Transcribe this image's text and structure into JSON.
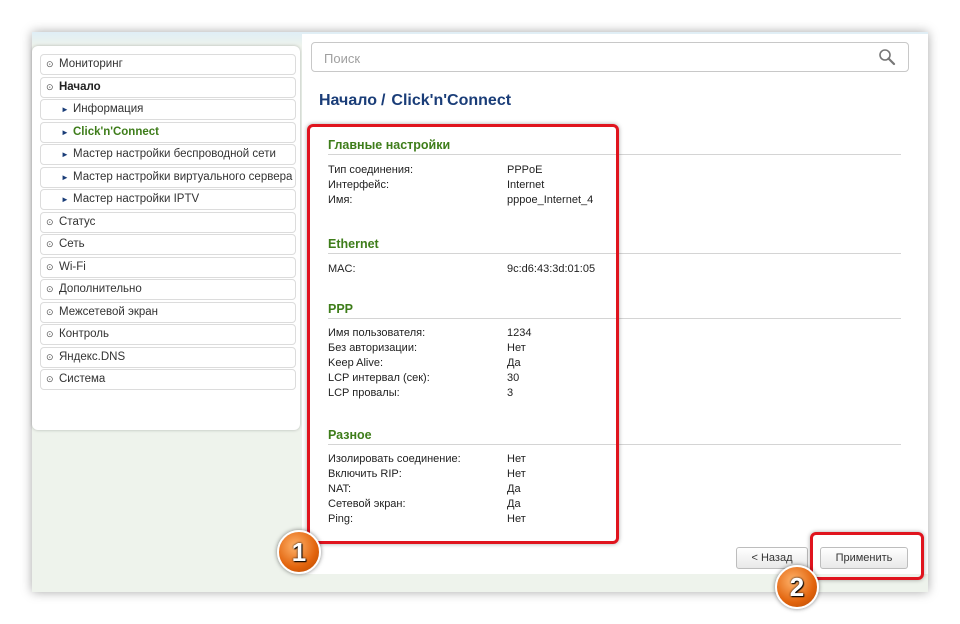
{
  "sidebar": {
    "items": [
      {
        "label": "Мониторинг",
        "level": 0,
        "icon": "circle-chevron-right-icon"
      },
      {
        "label": "Начало",
        "level": 0,
        "icon": "circle-chevron-down-icon"
      },
      {
        "label": "Информация",
        "level": 1,
        "icon": "triangle-right-icon"
      },
      {
        "label": "Click'n'Connect",
        "level": 1,
        "icon": "triangle-right-icon",
        "active": true
      },
      {
        "label": "Мастер настройки беспроводной сети",
        "level": 1,
        "icon": "triangle-right-icon"
      },
      {
        "label": "Мастер настройки виртуального сервера",
        "level": 1,
        "icon": "triangle-right-icon"
      },
      {
        "label": "Мастер настройки IPTV",
        "level": 1,
        "icon": "triangle-right-icon"
      },
      {
        "label": "Статус",
        "level": 0,
        "icon": "circle-chevron-right-icon"
      },
      {
        "label": "Сеть",
        "level": 0,
        "icon": "circle-chevron-right-icon"
      },
      {
        "label": "Wi-Fi",
        "level": 0,
        "icon": "circle-chevron-right-icon"
      },
      {
        "label": "Дополнительно",
        "level": 0,
        "icon": "circle-chevron-right-icon"
      },
      {
        "label": "Межсетевой экран",
        "level": 0,
        "icon": "circle-chevron-right-icon"
      },
      {
        "label": "Контроль",
        "level": 0,
        "icon": "circle-chevron-right-icon"
      },
      {
        "label": "Яндекс.DNS",
        "level": 0,
        "icon": "circle-chevron-right-icon"
      },
      {
        "label": "Система",
        "level": 0,
        "icon": "circle-chevron-right-icon"
      }
    ]
  },
  "search": {
    "placeholder": "Поиск",
    "value": "",
    "icon": "search-icon"
  },
  "breadcrumb": {
    "parent": "Начало",
    "separator": "/",
    "current": "Click'n'Connect"
  },
  "sections": {
    "main": {
      "title": "Главные настройки",
      "rows": [
        {
          "label": "Тип соединения:",
          "value": "PPPoE"
        },
        {
          "label": "Интерфейс:",
          "value": "Internet"
        },
        {
          "label": "Имя:",
          "value": "pppoe_Internet_4"
        }
      ]
    },
    "ethernet": {
      "title": "Ethernet",
      "rows": [
        {
          "label": "MAC:",
          "value": "9c:d6:43:3d:01:05"
        }
      ]
    },
    "ppp": {
      "title": "PPP",
      "rows": [
        {
          "label": "Имя пользователя:",
          "value": "1234"
        },
        {
          "label": "Без авторизации:",
          "value": "Нет"
        },
        {
          "label": "Keep Alive:",
          "value": "Да"
        },
        {
          "label": "LCP интервал (сек):",
          "value": "30"
        },
        {
          "label": "LCP провалы:",
          "value": "3"
        }
      ]
    },
    "misc": {
      "title": "Разное",
      "rows": [
        {
          "label": "Изолировать соединение:",
          "value": "Нет"
        },
        {
          "label": "Включить RIP:",
          "value": "Нет"
        },
        {
          "label": "NAT:",
          "value": "Да"
        },
        {
          "label": "Сетевой экран:",
          "value": "Да"
        },
        {
          "label": "Ping:",
          "value": "Нет"
        }
      ]
    }
  },
  "buttons": {
    "back": "< Назад",
    "apply": "Применить"
  },
  "annotations": {
    "badge1": "1",
    "badge2": "2",
    "highlight_color": "#e0141e"
  },
  "colors": {
    "accent_green": "#3e7d1a",
    "title_blue": "#1a3d78"
  }
}
